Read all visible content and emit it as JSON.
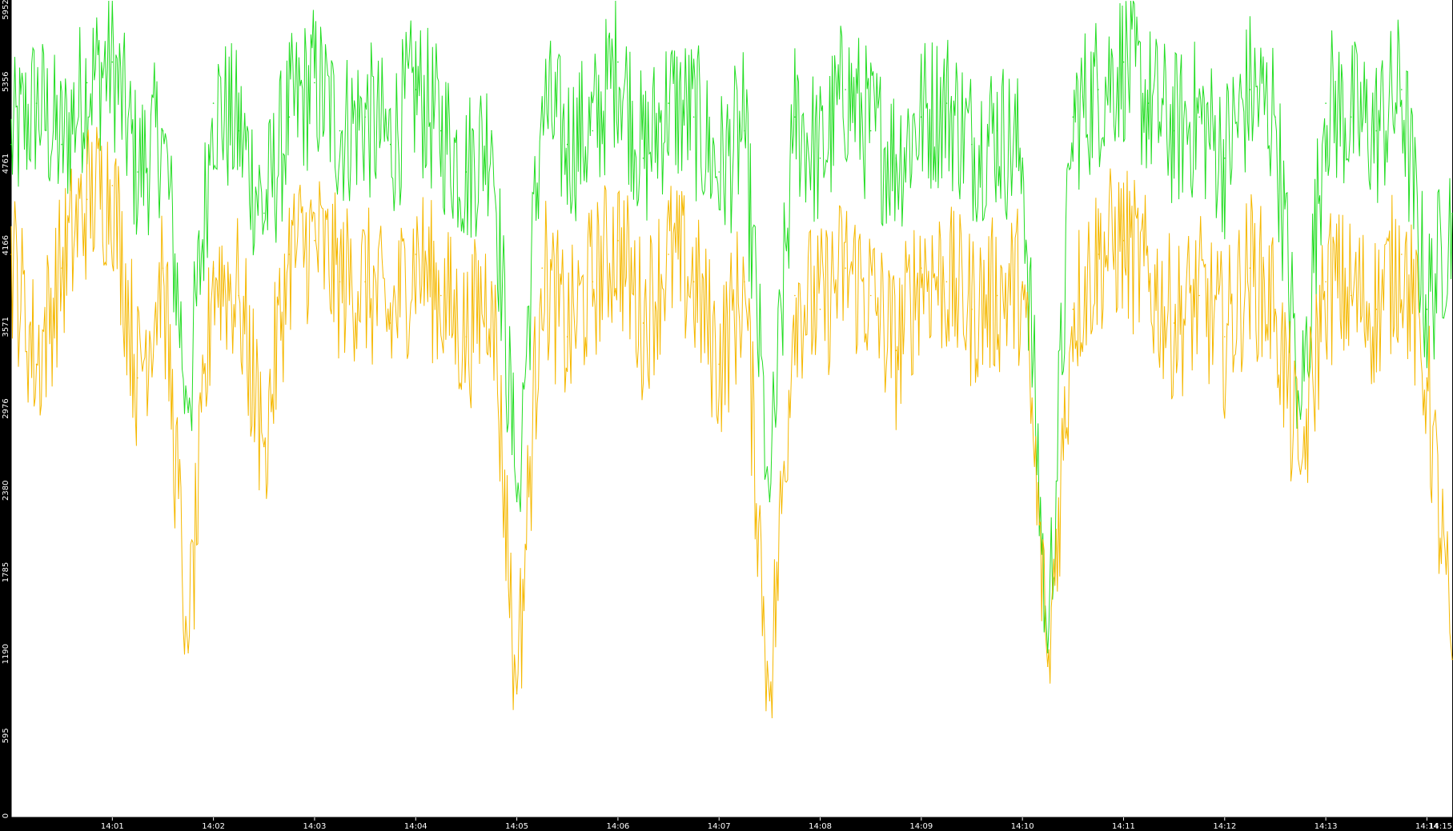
{
  "chart_data": {
    "type": "line",
    "title": "",
    "xlabel": "",
    "ylabel": "",
    "ylim": [
      0,
      5952
    ],
    "xlim": [
      "14:00:00",
      "14:14:15"
    ],
    "y_ticks": [
      0,
      595,
      1190,
      1785,
      2380,
      2976,
      3571,
      4166,
      4761,
      5356,
      5952
    ],
    "x_ticks": [
      "14:01",
      "14:02",
      "14:03",
      "14:04",
      "14:05",
      "14:06",
      "14:07",
      "14:08",
      "14:09",
      "14:10",
      "14:11",
      "14:12",
      "14:13",
      "14:14",
      "14:15"
    ],
    "grid": false,
    "legend": "none",
    "background_color": "#ffffff",
    "frame_color": "#000000",
    "series": [
      {
        "color": "#22dd22",
        "x": [
          "14:00:00",
          "14:00:15",
          "14:00:30",
          "14:00:45",
          "14:01:00",
          "14:01:15",
          "14:01:30",
          "14:01:45",
          "14:02:00",
          "14:02:15",
          "14:02:30",
          "14:02:45",
          "14:03:00",
          "14:03:15",
          "14:03:30",
          "14:03:45",
          "14:04:00",
          "14:04:15",
          "14:04:30",
          "14:04:45",
          "14:05:00",
          "14:05:15",
          "14:05:30",
          "14:05:45",
          "14:06:00",
          "14:06:15",
          "14:06:30",
          "14:06:45",
          "14:07:00",
          "14:07:15",
          "14:07:30",
          "14:07:45",
          "14:08:00",
          "14:08:15",
          "14:08:30",
          "14:08:45",
          "14:09:00",
          "14:09:15",
          "14:09:30",
          "14:09:45",
          "14:10:00",
          "14:10:15",
          "14:10:30",
          "14:10:45",
          "14:11:00",
          "14:11:15",
          "14:11:30",
          "14:11:45",
          "14:12:00",
          "14:12:15",
          "14:12:30",
          "14:12:45",
          "14:13:00",
          "14:13:15",
          "14:13:30",
          "14:13:45",
          "14:14:00",
          "14:14:15"
        ],
        "y": [
          4900,
          5200,
          4900,
          5350,
          5500,
          4700,
          5000,
          2950,
          5200,
          5000,
          4400,
          5100,
          5350,
          5000,
          5100,
          4900,
          5300,
          5000,
          4700,
          5000,
          2300,
          5200,
          4900,
          5000,
          5500,
          4800,
          5200,
          5100,
          4700,
          5000,
          2300,
          5100,
          4800,
          5300,
          5000,
          4800,
          5100,
          5200,
          4900,
          5000,
          4800,
          1200,
          5100,
          5300,
          5500,
          5200,
          5000,
          5100,
          4800,
          5300,
          5100,
          2900,
          5200,
          5100,
          5000,
          5300,
          3700,
          4400
        ]
      },
      {
        "color": "#f5b800",
        "x": [
          "14:00:00",
          "14:00:15",
          "14:00:30",
          "14:00:45",
          "14:01:00",
          "14:01:15",
          "14:01:30",
          "14:01:45",
          "14:02:00",
          "14:02:15",
          "14:02:30",
          "14:02:45",
          "14:03:00",
          "14:03:15",
          "14:03:30",
          "14:03:45",
          "14:04:00",
          "14:04:15",
          "14:04:30",
          "14:04:45",
          "14:05:00",
          "14:05:15",
          "14:05:30",
          "14:05:45",
          "14:06:00",
          "14:06:15",
          "14:06:30",
          "14:06:45",
          "14:07:00",
          "14:07:15",
          "14:07:30",
          "14:07:45",
          "14:08:00",
          "14:08:15",
          "14:08:30",
          "14:08:45",
          "14:09:00",
          "14:09:15",
          "14:09:30",
          "14:09:45",
          "14:10:00",
          "14:10:15",
          "14:10:30",
          "14:10:45",
          "14:11:00",
          "14:11:15",
          "14:11:30",
          "14:11:45",
          "14:12:00",
          "14:12:15",
          "14:12:30",
          "14:12:45",
          "14:13:00",
          "14:13:15",
          "14:13:30",
          "14:13:45",
          "14:14:00",
          "14:14:15"
        ],
        "y": [
          4100,
          3300,
          4000,
          4500,
          4600,
          3200,
          4000,
          1200,
          4000,
          3800,
          2700,
          4100,
          4200,
          3900,
          3900,
          3600,
          4100,
          3800,
          3500,
          3900,
          900,
          4000,
          3500,
          3900,
          4200,
          3600,
          4100,
          3900,
          3300,
          3900,
          850,
          3800,
          3700,
          4000,
          3800,
          3400,
          4000,
          3900,
          3700,
          3800,
          3900,
          1100,
          3700,
          4100,
          4200,
          3900,
          3600,
          3800,
          3500,
          4000,
          3700,
          2500,
          3900,
          3800,
          3700,
          4100,
          3200,
          1150
        ]
      }
    ]
  }
}
